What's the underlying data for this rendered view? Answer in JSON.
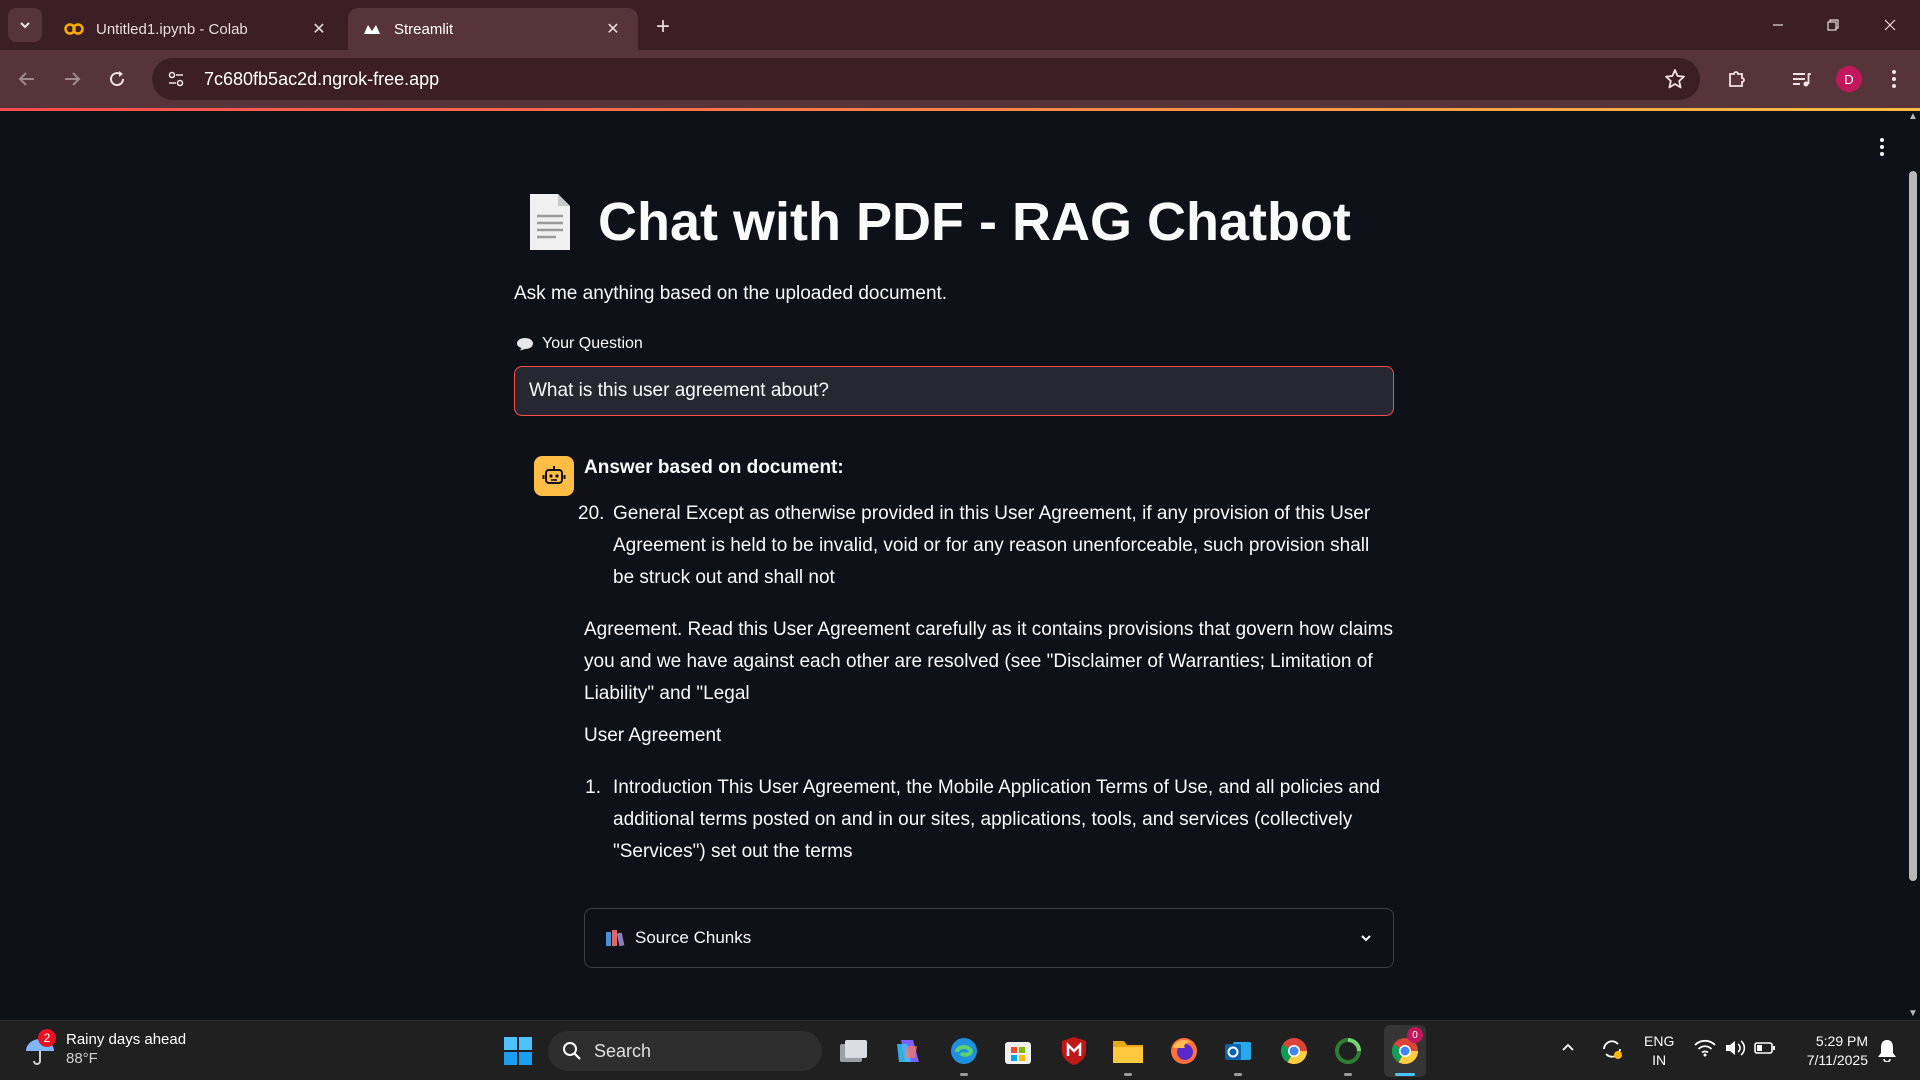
{
  "browser": {
    "tabs": [
      {
        "title": "Untitled1.ipynb - Colab",
        "favicon": "colab-icon"
      },
      {
        "title": "Streamlit",
        "favicon": "streamlit-icon"
      }
    ],
    "url": "7c680fb5ac2d.ngrok-free.app",
    "profile_initial": "D"
  },
  "page": {
    "title": "Chat with PDF - RAG Chatbot",
    "subtitle": "Ask me anything based on the uploaded document.",
    "question_label": "Your Question",
    "question_value": "What is this user agreement about?",
    "answer_heading": "Answer based on document:",
    "answer_item_20_num": "20.",
    "answer_item_20_text": "General Except as otherwise provided in this User Agreement, if any provision of this User Agreement is held to be invalid, void or for any reason unenforceable, such provision shall be struck out and shall not",
    "answer_para_1": "Agreement. Read this User Agreement carefully as it contains provisions that govern how claims you and we have against each other are resolved (see \"Disclaimer of Warranties; Limitation of Liability\" and \"Legal",
    "answer_para_2": "User Agreement",
    "answer_item_1_num": "1.",
    "answer_item_1_text": "Introduction This User Agreement, the Mobile Application Terms of Use, and all policies and additional terms posted on and in our sites, applications, tools, and services (collectively \"Services\") set out the terms",
    "expander_label": "Source Chunks"
  },
  "taskbar": {
    "weather_badge": "2",
    "weather_text": "Rainy days ahead",
    "weather_temp": "88°F",
    "search_placeholder": "Search",
    "chrome_badge": "0",
    "lang_1": "ENG",
    "lang_2": "IN",
    "time": "5:29 PM",
    "date": "7/11/2025"
  },
  "colors": {
    "accent": "#ff4b4b",
    "avatar": "#ffbd45",
    "background": "#0e1117",
    "input_bg": "#262730",
    "chrome_frame": "#3c1f24",
    "chrome_toolbar": "#56343a"
  }
}
